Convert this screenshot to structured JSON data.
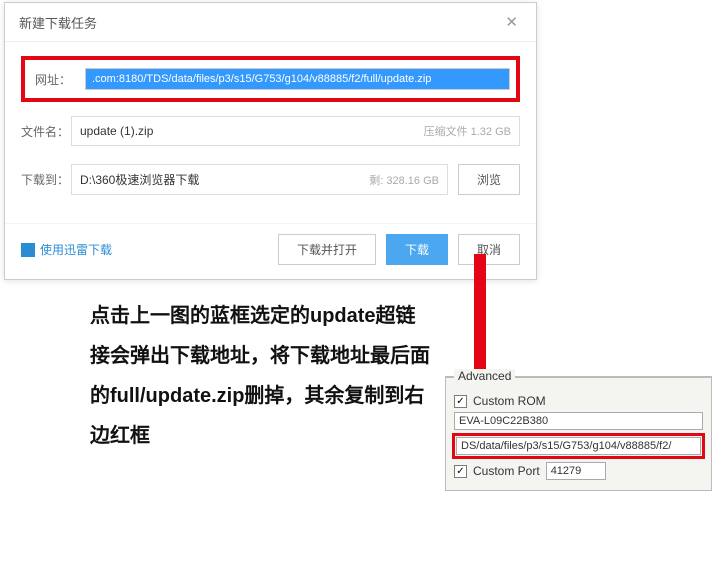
{
  "dialog": {
    "title": "新建下载任务",
    "url_label": "网址：",
    "url_value": ".com:8180/TDS/data/files/p3/s15/G753/g104/v88885/f2/full/update.zip",
    "filename_label": "文件名：",
    "filename_value": "update (1).zip",
    "filename_hint": "压缩文件 1.32 GB",
    "path_label": "下载到：",
    "path_value": "D:\\360极速浏览器下载",
    "path_hint": "剩: 328.16 GB",
    "browse_btn": "浏览",
    "xunlei_link": "使用迅雷下载",
    "download_open_btn": "下载并打开",
    "download_btn": "下载",
    "cancel_btn": "取消"
  },
  "instruction": {
    "text": "点击上一图的蓝框选定的update超链接会弹出下载地址，将下载地址最后面的full/update.zip删掉，其余复制到右边红框"
  },
  "advanced": {
    "legend": "Advanced",
    "custom_rom_label": "Custom ROM",
    "rom_name": "EVA-L09C22B380",
    "rom_path": "DS/data/files/p3/s15/G753/g104/v88885/f2/",
    "custom_port_label": "Custom Port",
    "port_value": "41279"
  }
}
